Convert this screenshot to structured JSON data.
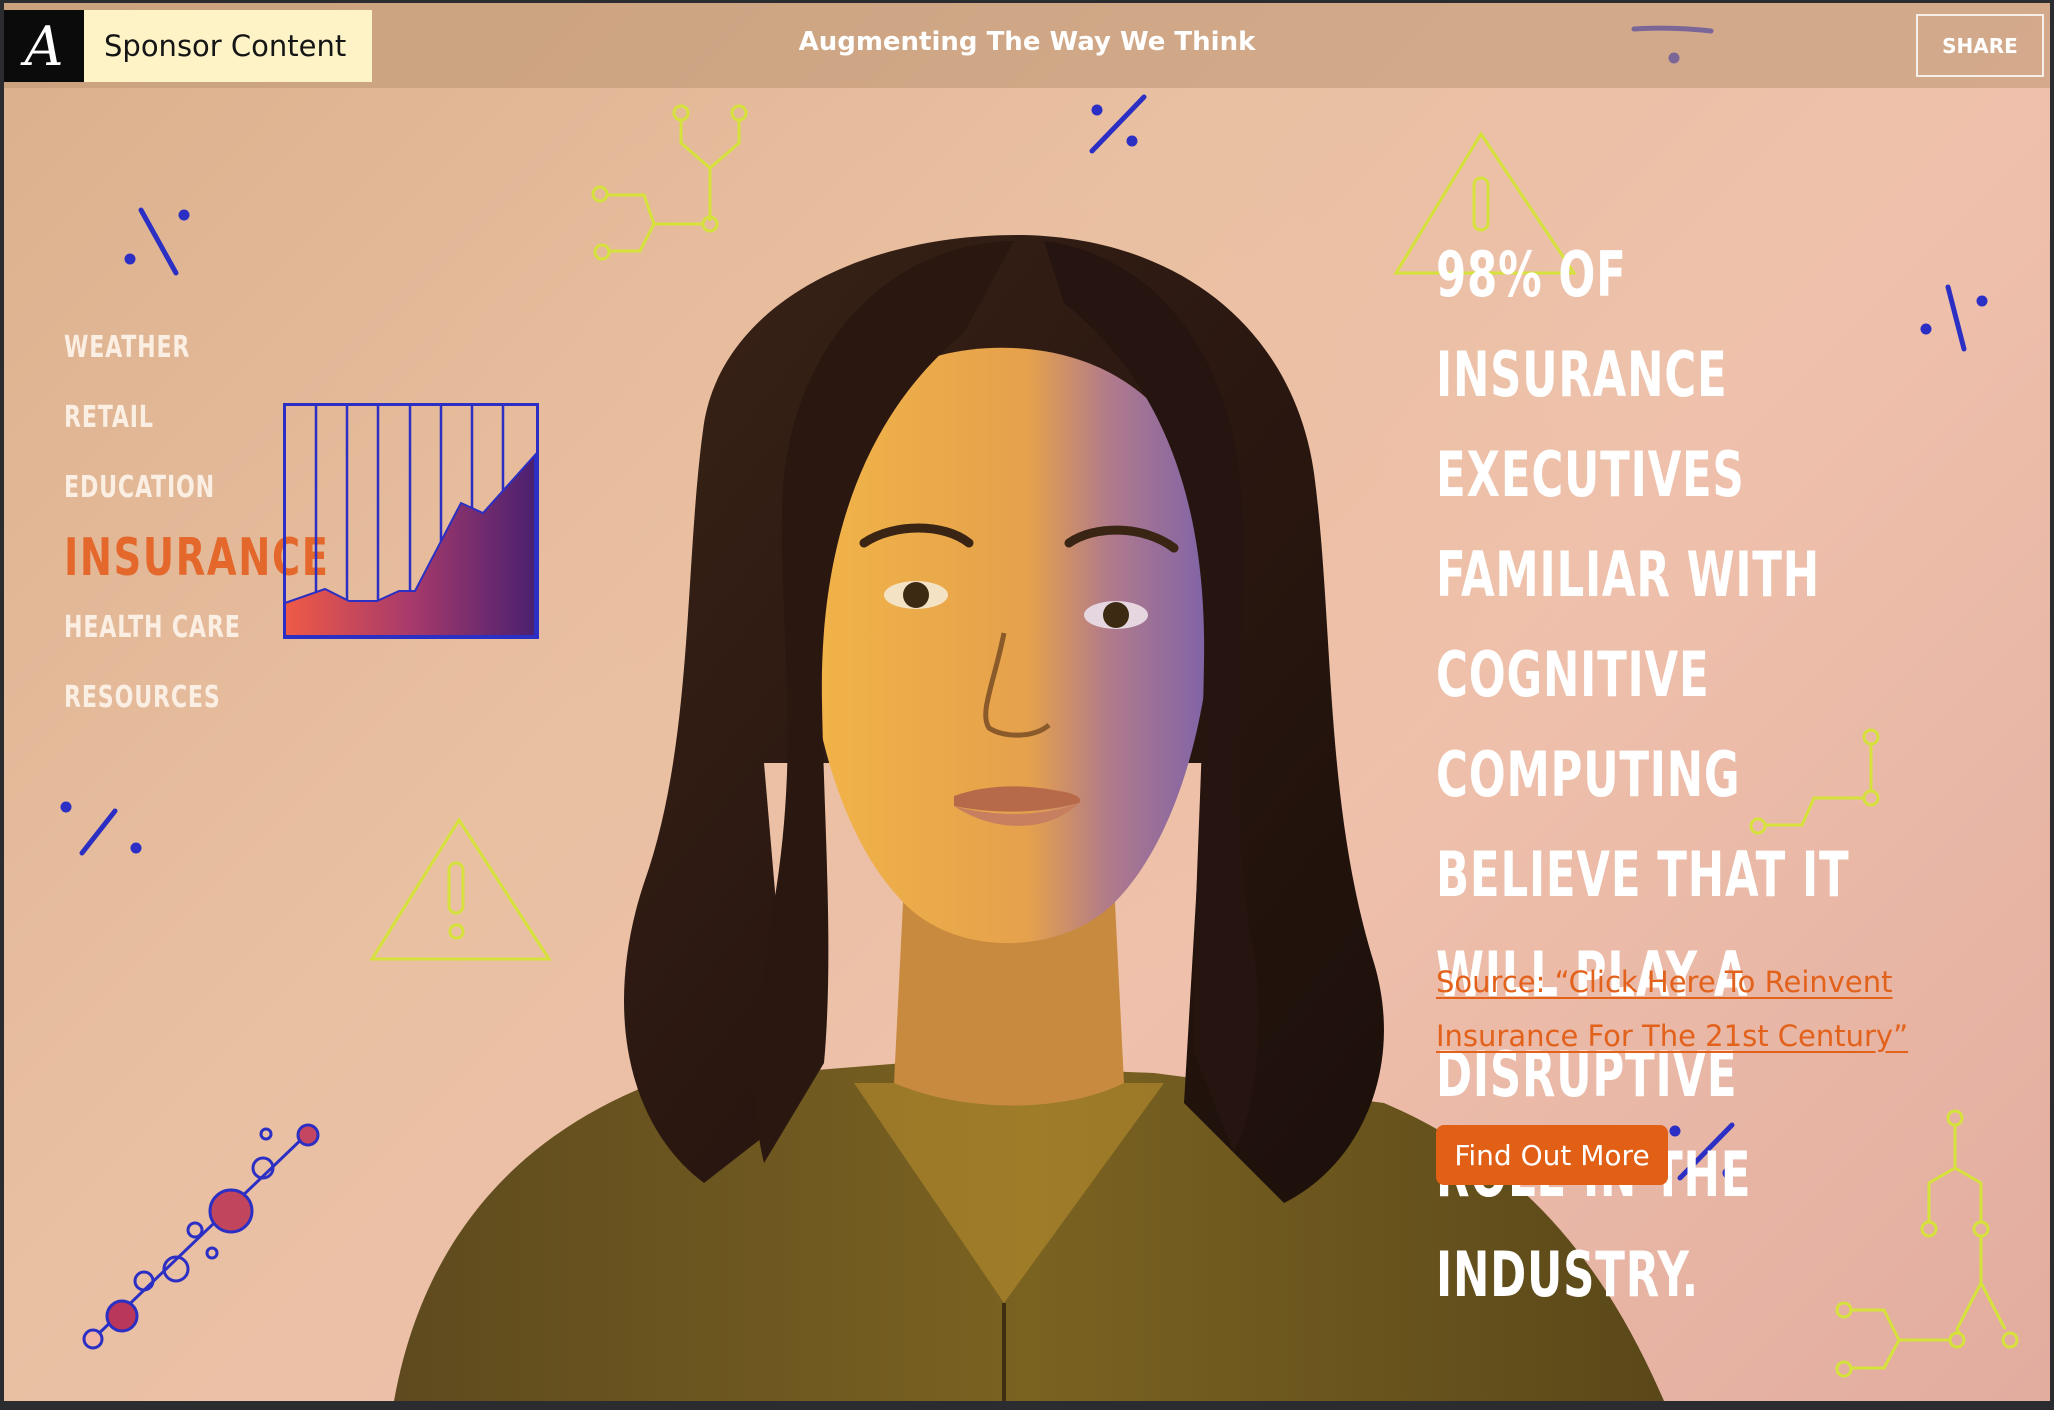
{
  "header": {
    "logo_letter": "A",
    "sponsor_label": "Sponsor Content",
    "tagline": "Augmenting The Way We Think",
    "share_label": "SHARE"
  },
  "sidenav": {
    "items": [
      {
        "label": "WEATHER",
        "active": false
      },
      {
        "label": "RETAIL",
        "active": false
      },
      {
        "label": "EDUCATION",
        "active": false
      },
      {
        "label": "INSURANCE",
        "active": true
      },
      {
        "label": "HEALTH CARE",
        "active": false
      },
      {
        "label": "RESOURCES",
        "active": false
      }
    ]
  },
  "main": {
    "headline": "98% of insurance executives familiar with cognitive computing believe that it will play a disruptive role in the industry.",
    "source_link": "Source: “Click Here To Reinvent Insurance For The 21st Century”",
    "cta_label": "Find Out More"
  },
  "icons": [
    "logo-icon",
    "bar-chart-icon",
    "warning-triangle-icon",
    "molecule-icon",
    "circuit-node-icon",
    "slash-accent-icon"
  ],
  "colors": {
    "accent": "#e25f16",
    "nav_active": "#e4682b",
    "deco_blue": "#2b2fc4",
    "deco_lime": "#d6e23c",
    "sponsor_bg": "#fdf3c6"
  }
}
